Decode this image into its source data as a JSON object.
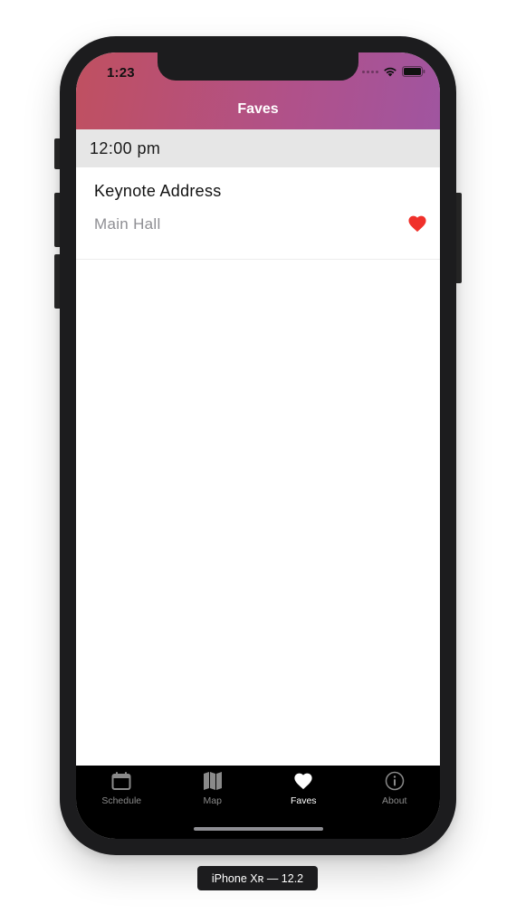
{
  "status_bar": {
    "time": "1:23"
  },
  "nav": {
    "title": "Faves"
  },
  "sections": [
    {
      "header": "12:00 pm",
      "items": [
        {
          "title": "Keynote Address",
          "location": "Main Hall",
          "favorited": true
        }
      ]
    }
  ],
  "tabs": [
    {
      "label": "Schedule",
      "icon": "calendar-icon",
      "active": false
    },
    {
      "label": "Map",
      "icon": "map-icon",
      "active": false
    },
    {
      "label": "Faves",
      "icon": "heart-icon",
      "active": true
    },
    {
      "label": "About",
      "icon": "info-icon",
      "active": false
    }
  ],
  "device_label": "iPhone Xʀ — 12.2",
  "colors": {
    "header_gradient_start": "#c05060",
    "header_gradient_end": "#a055a0",
    "heart": "#f0302a",
    "tab_active": "#ffffff",
    "tab_inactive": "#8a8a8a"
  }
}
